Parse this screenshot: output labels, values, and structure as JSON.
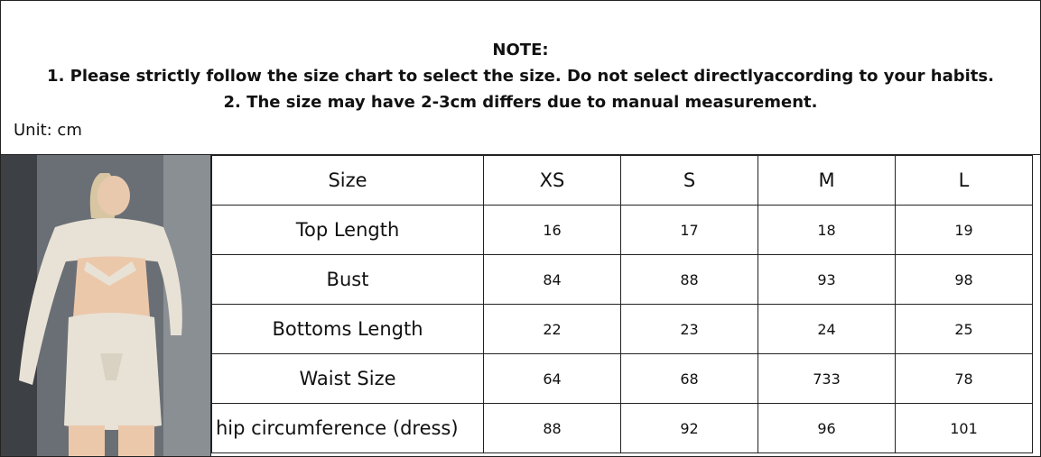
{
  "header": {
    "note_title": "NOTE:",
    "line1": "1. Please strictly follow the size chart to select the size. Do not select directlyaccording to your habits.",
    "line2": "2. The size may have 2-3cm differs due to manual measurement.",
    "unit": "Unit: cm"
  },
  "table": {
    "columns": [
      "Size",
      "XS",
      "S",
      "M",
      "L"
    ],
    "rows": [
      [
        "Top Length",
        "16",
        "17",
        "18",
        "19"
      ],
      [
        "Bust",
        "84",
        "88",
        "93",
        "98"
      ],
      [
        "Bottoms Length",
        "22",
        "23",
        "24",
        "25"
      ],
      [
        "Waist Size",
        "64",
        "68",
        "733",
        "78"
      ],
      [
        "hip circumference  (dress)",
        "88",
        "92",
        "96",
        "101"
      ]
    ]
  },
  "colors": {
    "border": "#222222",
    "background": "#ffffff",
    "photo_background": "#6a6f75",
    "garment": "#e8e2d6"
  }
}
